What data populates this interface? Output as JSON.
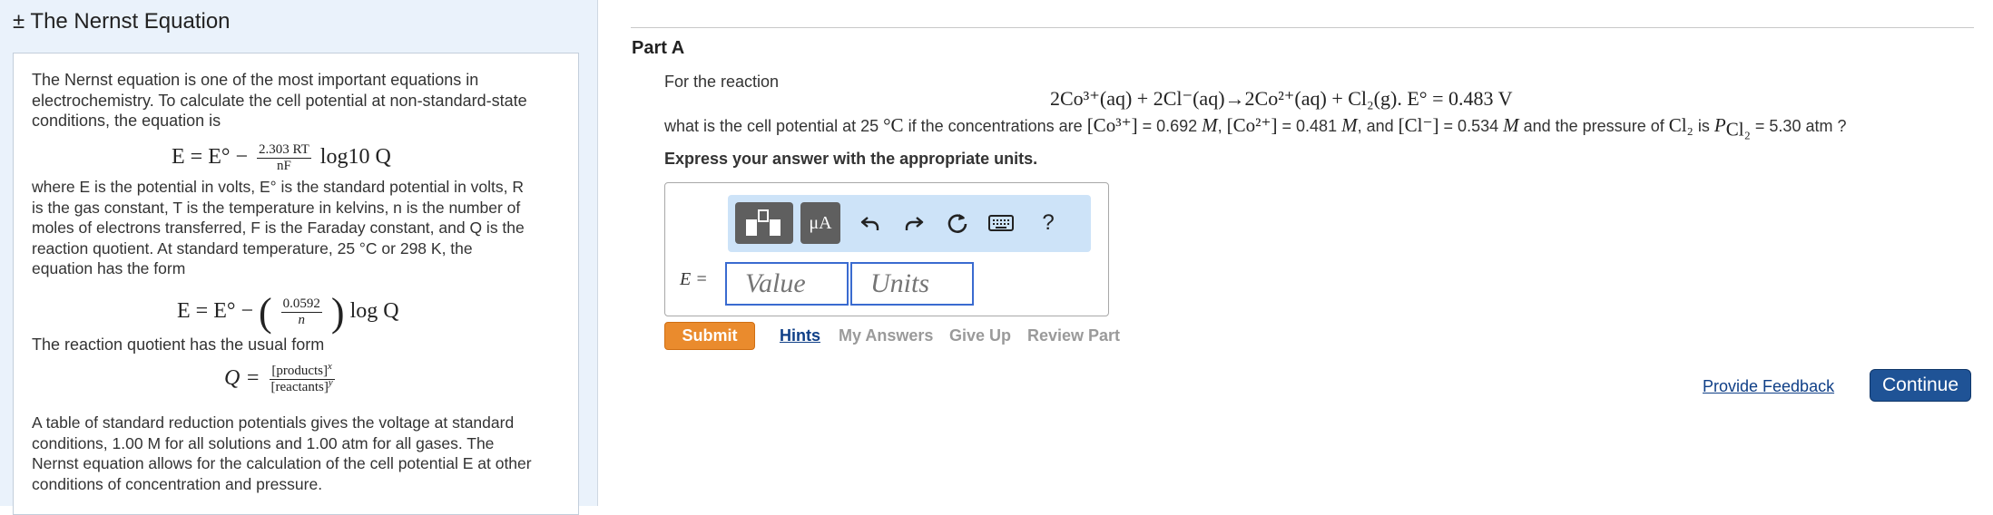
{
  "intro": {
    "title": "± The Nernst Equation",
    "p1": "The Nernst equation is one of the most important equations in electrochemistry. To calculate the cell potential at non-standard-state conditions, the equation is",
    "eq1_lhs": "E = E° −",
    "eq1_num": "2.303 RT",
    "eq1_den": "nF",
    "eq1_tail": "log10 Q",
    "p2_line1": "where E is the potential in volts, E° is the standard potential in volts, R",
    "p2_line2": "is the gas constant, T is the temperature in kelvins, n is the number of",
    "p2_line3": "moles of electrons transferred, F is the Faraday constant, and Q is the",
    "p2_line4": "reaction quotient. At standard temperature, 25 °C or 298 K, the",
    "p2_line5": "equation has the form",
    "eq2_lhs": "E = E° −",
    "eq2_num": "0.0592",
    "eq2_den": "n",
    "eq2_tail": "log Q",
    "p3": "The reaction quotient has the usual form",
    "eq3_lhs": "Q =",
    "eq3_num": "[products]",
    "eq3_num_exp": "x",
    "eq3_den": "[reactants]",
    "eq3_den_exp": "y",
    "p4_line1": "A table of standard reduction potentials gives the voltage at standard",
    "p4_line2": "conditions, 1.00 M for all solutions and 1.00 atm for all gases. The",
    "p4_line3": "Nernst equation allows for the calculation of the cell potential E at other",
    "p4_line4": "conditions of concentration and pressure."
  },
  "part": {
    "label": "Part A",
    "reaction_intro": "For the reaction",
    "reaction": "2Co³⁺(aq) + 2Cl⁻(aq)→2Co²⁺(aq) + Cl₂(g).   E° = 0.483 V",
    "question_a": "what is the cell potential at 25 ",
    "question_temp_unit": "°C",
    "question_b": " if the concentrations are ",
    "conc_co3": "[Co³⁺]",
    "conc_co3_val": " = 0.692 ",
    "conc_co2": "[Co²⁺]",
    "conc_co2_val": " = 0.481 ",
    "conc_cl": "[Cl⁻]",
    "conc_cl_val": " = 0.534 ",
    "molar": "M",
    "and_text": ", and ",
    "comma": ", ",
    "pressure_a": " and the pressure of ",
    "cl2": "Cl₂",
    "is_text": " is ",
    "p_cl2": "P",
    "p_cl2_sub": "Cl₂",
    "p_val": " = 5.30 atm",
    "q_mark": " ?",
    "instruction": "Express your answer with the appropriate units."
  },
  "answer": {
    "label": "E =",
    "value_placeholder": "Value",
    "units_placeholder": "Units",
    "toolbar": {
      "units_button_label": "μA",
      "help_label": "?"
    }
  },
  "actions": {
    "submit": "Submit",
    "hints": "Hints",
    "my_answers": "My Answers",
    "give_up": "Give Up",
    "review_part": "Review Part"
  },
  "footer": {
    "feedback": "Provide Feedback",
    "continue": "Continue"
  }
}
